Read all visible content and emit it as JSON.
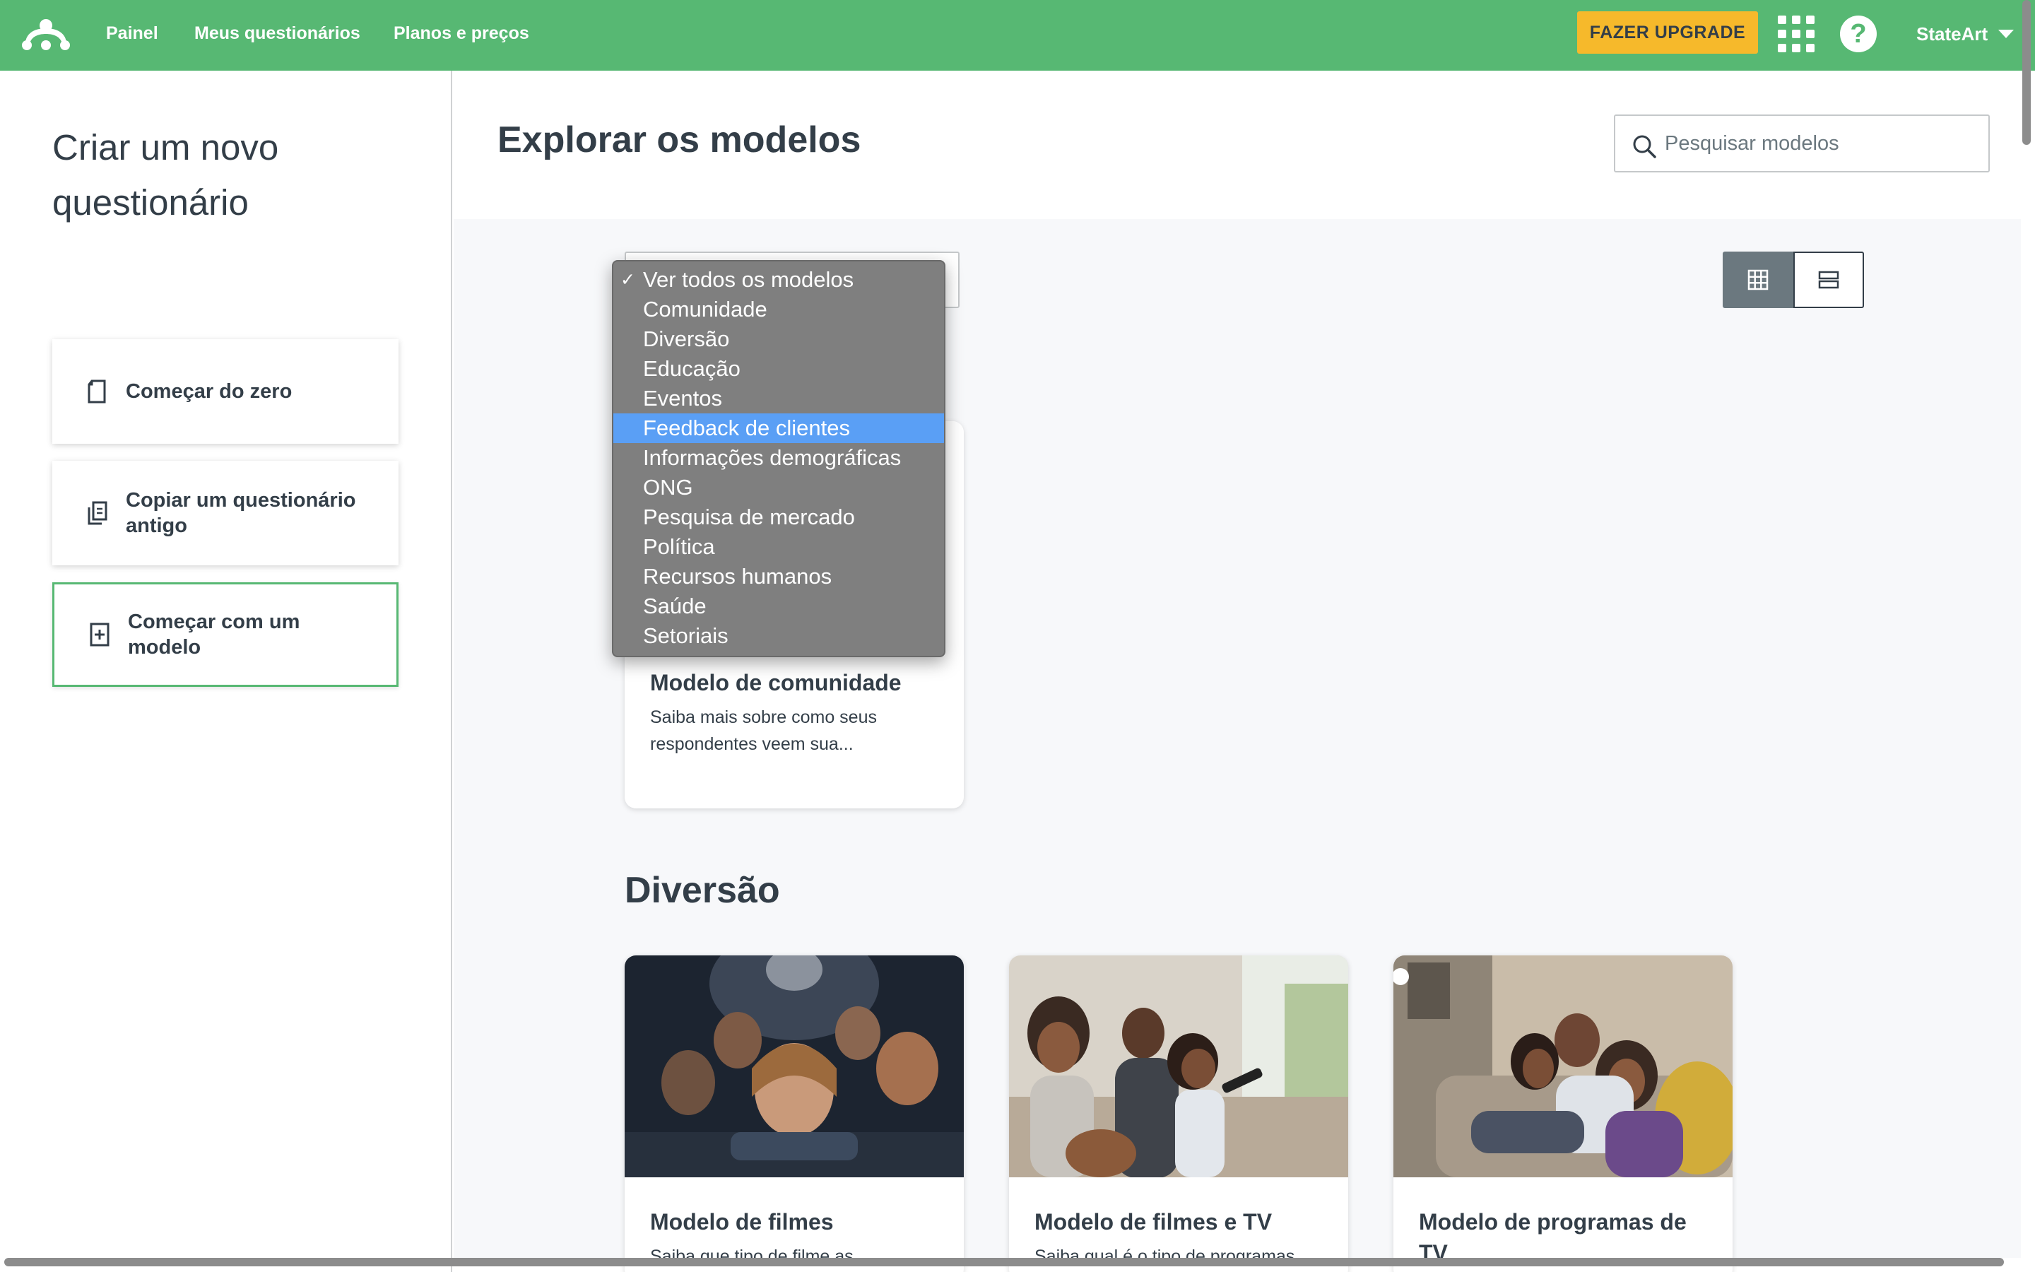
{
  "nav": {
    "links": [
      "Painel",
      "Meus questionários",
      "Planos e preços"
    ],
    "upgrade_label": "FAZER UPGRADE",
    "user_name": "StateArt",
    "help_glyph": "?"
  },
  "sidebar": {
    "title": "Criar um novo questionário",
    "options": [
      {
        "label": "Começar do zero",
        "icon": "blank-document-icon"
      },
      {
        "label": "Copiar um questionário antigo",
        "icon": "copy-document-icon"
      },
      {
        "label": "Começar com um modelo",
        "icon": "template-document-icon",
        "active": true
      }
    ]
  },
  "main": {
    "title": "Explorar os modelos",
    "search_placeholder": "Pesquisar modelos",
    "view_modes": [
      "grid-view-icon",
      "list-view-icon"
    ],
    "selected_view": "grid"
  },
  "category_dropdown": {
    "selected": "Ver todos os modelos",
    "highlighted": "Feedback de clientes",
    "options": [
      "Ver todos os modelos",
      "Comunidade",
      "Diversão",
      "Educação",
      "Eventos",
      "Feedback de clientes",
      "Informações demográficas",
      "ONG",
      "Pesquisa de mercado",
      "Política",
      "Recursos humanos",
      "Saúde",
      "Setoriais"
    ],
    "check_glyph": "✓"
  },
  "sections": {
    "community_card": {
      "title": "Modelo de comunidade",
      "desc": "Saiba mais sobre como seus respondentes veem sua..."
    },
    "diversao": {
      "heading": "Diversão",
      "cards": [
        {
          "title": "Modelo de filmes",
          "desc": "Saiba que tipo de filme as"
        },
        {
          "title": "Modelo de filmes e TV",
          "desc": "Saiba qual é o tipo de programas"
        },
        {
          "title": "Modelo de programas de TV",
          "desc": ""
        }
      ]
    }
  },
  "colors": {
    "brand_green": "#57b873",
    "upgrade_yellow": "#f6b92b",
    "dropdown_bg": "#7f7f7f",
    "dropdown_highlight": "#5a9ff5"
  }
}
